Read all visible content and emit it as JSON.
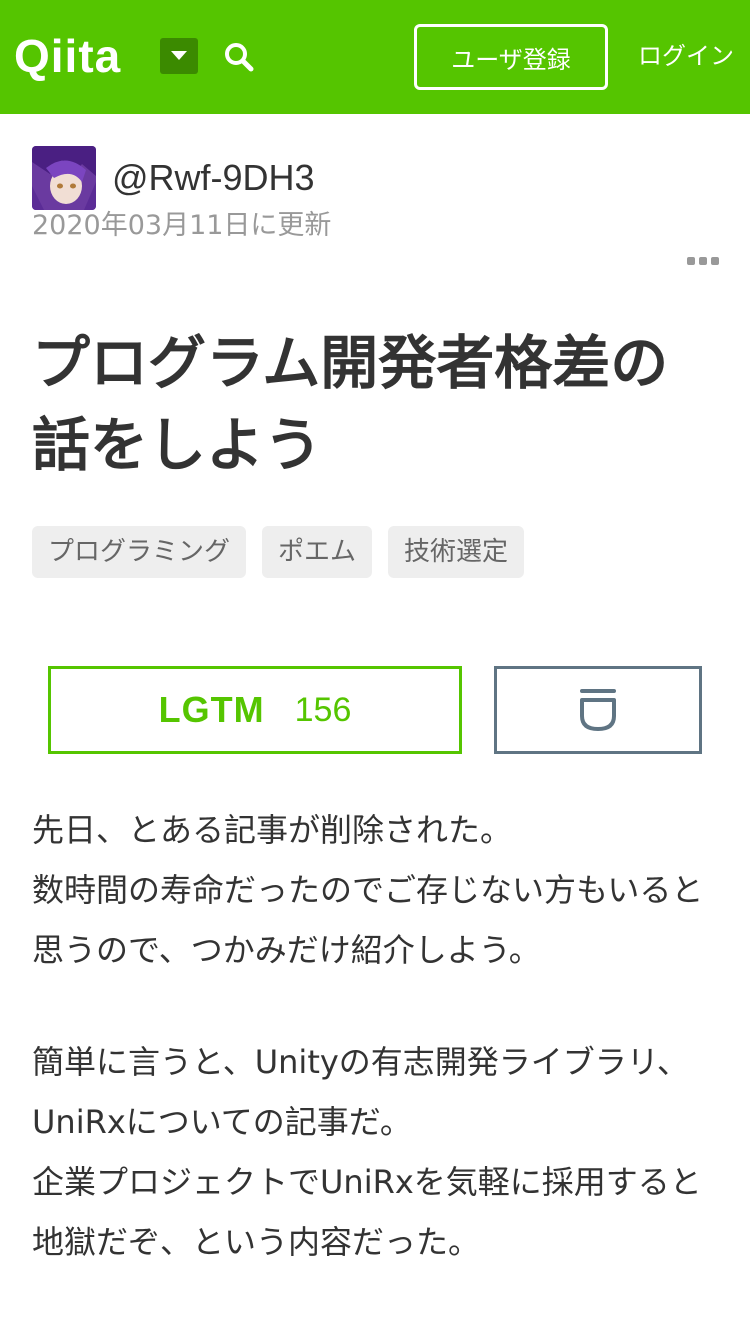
{
  "header": {
    "logo": "Qiita",
    "signup_label": "ユーザ登録",
    "login_label": "ログイン",
    "bg_color": "#55c500"
  },
  "author": {
    "username": "@Rwf-9DH3",
    "updated": "2020年03月11日に更新"
  },
  "article": {
    "title": "プログラム開発者格差の話をしよう",
    "tags": [
      "プログラミング",
      "ポエム",
      "技術選定"
    ],
    "lgtm_label": "LGTM",
    "lgtm_count": "156",
    "paragraphs": [
      [
        "先日、とある記事が削除された。",
        "数時間の寿命だったのでご存じない方もいると",
        "思うので、つかみだけ紹介しよう。"
      ],
      [
        "簡単に言うと、Unityの有志開発ライブラリ、",
        "UniRxについての記事だ。",
        "企業プロジェクトでUniRxを気軽に採用すると",
        "地獄だぞ、という内容だった。"
      ]
    ]
  },
  "icons": {
    "dropdown": "chevron-down-icon",
    "search": "search-icon",
    "more": "more-icon",
    "stock": "stock-icon"
  }
}
